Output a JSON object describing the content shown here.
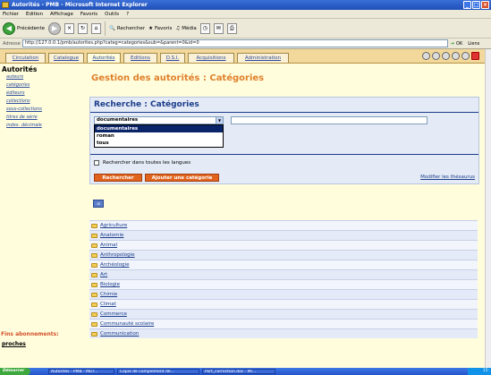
{
  "window": {
    "title": "Autorités - PMB - Microsoft Internet Explorer"
  },
  "menu": [
    "Fichier",
    "Edition",
    "Affichage",
    "Favoris",
    "Outils",
    "?"
  ],
  "toolbar": {
    "back": "Précédente",
    "search": "Rechercher",
    "favorites": "Favoris",
    "media": "Média"
  },
  "address": {
    "label": "Adresse",
    "url": "http://127.0.0.1/pmb/autorites.php?categ=categories&sub=&parent=0&id=0",
    "go": "OK",
    "links": "Liens"
  },
  "tabs": [
    "Circulation",
    "Catalogue",
    "Autorités",
    "Editions",
    "D.S.I.",
    "Acquisitions",
    "Administration"
  ],
  "sidebar": {
    "title": "Autorités",
    "items": [
      "auteurs",
      "catégories",
      "éditeurs",
      "collections",
      "sous-collections",
      "titres de série",
      "index. décimale"
    ],
    "alert": "Fins abonnements:",
    "proches": "proches"
  },
  "main": {
    "title": "Gestion des autorités : Catégories"
  },
  "search": {
    "title": "Recherche : Catégories",
    "select_value": "documentaires",
    "options": [
      "documentaires",
      "roman",
      "tous"
    ],
    "all_languages": "Rechercher dans toutes les langues",
    "search_button": "Rechercher",
    "add_button": "Ajouter une catégorie",
    "thesaurus_link": "Modifier les thésaurus"
  },
  "categories": [
    "Agriculture",
    "Anatomie",
    "Animal",
    "Anthropologie",
    "Archéologie",
    "Art",
    "Biologie",
    "Chimie",
    "Climat",
    "Commerce",
    "Communauté scolaire",
    "Communication"
  ],
  "taskbar": {
    "start": "Démarrer",
    "tasks": [
      "Autorités - PMB - Micr...",
      "Copie de complement de...",
      "Port_correction.doc - Mi..."
    ],
    "clock": "15:"
  }
}
